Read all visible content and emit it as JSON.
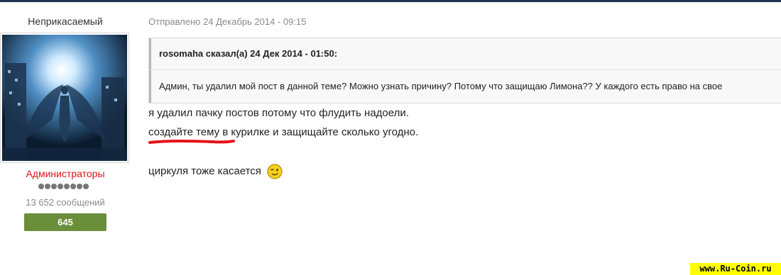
{
  "author": {
    "username": "Неприкасаемый",
    "group": "Администраторы",
    "rank_pips": 8,
    "post_count": "13 652 сообщений",
    "reputation": "645"
  },
  "post": {
    "posted_label": "Отправлено 24 Декабрь 2014 - 09:15",
    "quote": {
      "header": "rosomaha сказал(а) 24 Дек 2014 - 01:50:",
      "text": "Админ, ты удалил мой пост в данной теме? Можно узнать причину? Потому что защищаю Лимона?? У каждого есть право на свое"
    },
    "lines": [
      "я удалил пачку постов потому что флудить надоели.",
      "создайте тему в курилке и защищайте сколько угодно.",
      "циркуля тоже касается"
    ],
    "smiley": "wink-smiley-icon"
  },
  "watermark": "www.Ru-Coin.ru",
  "colors": {
    "group": "#e0141e",
    "reputation_bg": "#6b8e3b",
    "highlight_underline": "#e8101a",
    "watermark_bg": "#ffff00"
  }
}
